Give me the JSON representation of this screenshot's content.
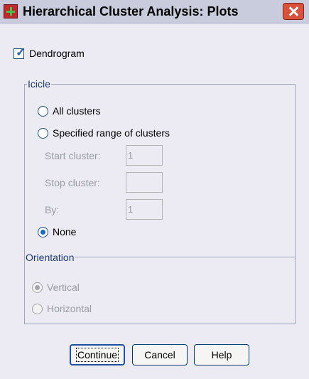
{
  "window": {
    "title": "Hierarchical Cluster Analysis: Plots"
  },
  "dendrogram": {
    "label": "Dendrogram",
    "checked": true
  },
  "icicle": {
    "group_title": "Icicle",
    "all_clusters_label": "All clusters",
    "specified_range_label": "Specified range of clusters",
    "start_cluster_label": "Start cluster:",
    "start_cluster_value": "1",
    "stop_cluster_label": "Stop cluster:",
    "stop_cluster_value": "",
    "by_label": "By:",
    "by_value": "1",
    "none_label": "None",
    "selected": "None"
  },
  "orientation": {
    "group_title": "Orientation",
    "vertical_label": "Vertical",
    "horizontal_label": "Horizontal",
    "selected": "Vertical"
  },
  "buttons": {
    "continue_label": "Continue",
    "cancel_label": "Cancel",
    "help_label": "Help"
  },
  "icons": {
    "app": "spss-dialog-icon",
    "close": "close-icon"
  },
  "colors": {
    "titlebar": "#c8ccdc",
    "close_button": "#d8523e",
    "dialog_background": "#ecebf3"
  }
}
